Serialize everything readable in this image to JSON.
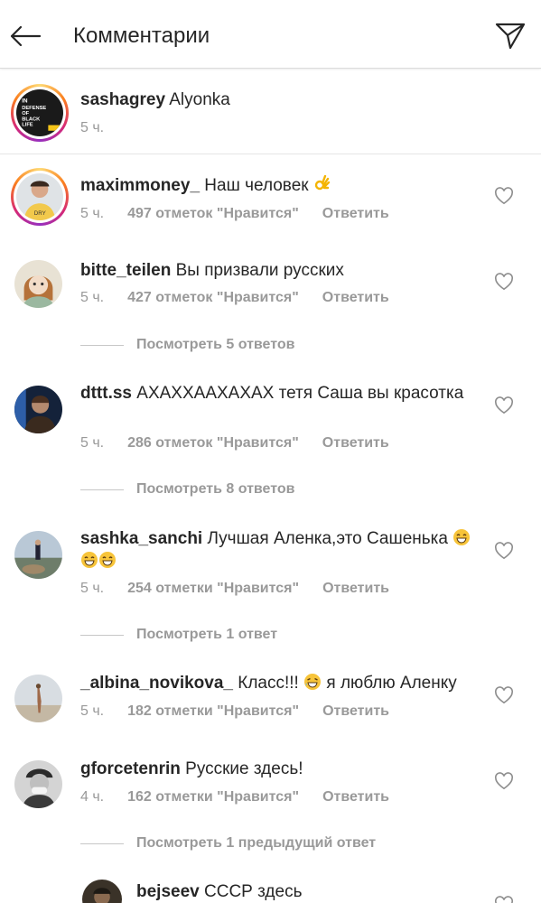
{
  "header": {
    "title": "Комментарии",
    "back_icon": "arrow-left-icon",
    "send_icon": "paper-plane-icon"
  },
  "caption": {
    "username": "sashagrey",
    "text": "Alyonka",
    "time": "5 ч."
  },
  "comments": [
    {
      "username": "maximmoney_",
      "text": "Наш человек",
      "emoji": "ok-hand",
      "time": "5 ч.",
      "likes": "497 отметок \"Нравится\"",
      "reply": "Ответить"
    },
    {
      "username": "bitte_teilen",
      "text": "Вы призвали русских",
      "time": "5 ч.",
      "likes": "427 отметок \"Нравится\"",
      "reply": "Ответить",
      "view_replies": "Посмотреть 5 ответов"
    },
    {
      "username": "dttt.ss",
      "text": "АХАХХААХАХАХ тетя Саша вы красотка",
      "time": "5 ч.",
      "likes": "286 отметок \"Нравится\"",
      "reply": "Ответить",
      "view_replies": "Посмотреть 8 ответов"
    },
    {
      "username": "sashka_sanchi",
      "text": "Лучшая Аленка,это Сашенька",
      "emoji": "grin x3",
      "time": "5 ч.",
      "likes": "254 отметки \"Нравится\"",
      "reply": "Ответить",
      "view_replies": "Посмотреть 1 ответ"
    },
    {
      "username": "_albina_novikova_",
      "text_before": "Класс!!!",
      "text_after": "я люблю Аленку",
      "emoji": "laughing",
      "time": "5 ч.",
      "likes": "182 отметки \"Нравится\"",
      "reply": "Ответить"
    },
    {
      "username": "gforcetenrin",
      "text": "Русские здесь!",
      "time": "4 ч.",
      "likes": "162 отметки \"Нравится\"",
      "reply": "Ответить",
      "view_replies": "Посмотреть 1 предыдущий ответ"
    },
    {
      "username": "bejseev",
      "text": "СССР здесь"
    }
  ]
}
